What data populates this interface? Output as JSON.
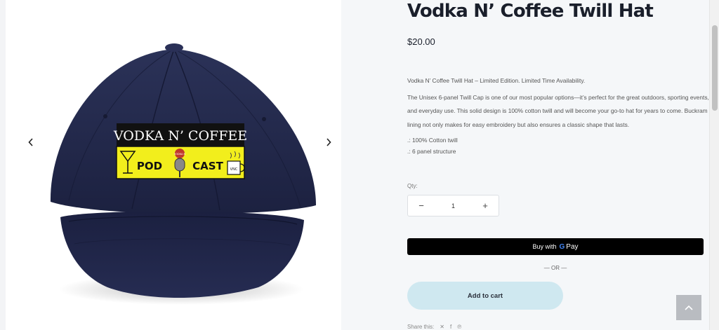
{
  "product": {
    "title": "Vodka N’ Coffee Twill Hat",
    "price": "$20.00",
    "description": {
      "intro": "Vodka N’ Coffee Twill Hat – Limited Edition.  Limited Time Availability.",
      "body": "The Unisex 6-panel Twill Cap is one of our most popular options—it’s perfect for the great outdoors, sporting events, and everyday use. This solid design is 100% cotton twill and will become your go-to hat for years to come. Buckram lining not only makes for easy embroidery but also ensures a classic shape that lasts.",
      "bullets": [
        ".: 100% Cotton twill",
        ".: 6 panel structure"
      ]
    }
  },
  "hat": {
    "patch_title": "VODKA N’ COFFEE",
    "patch_left": "POD",
    "patch_right": "CAST",
    "mug_text": "VNC",
    "mic_tag": "VODKA N",
    "colors": {
      "cap": "#23294a",
      "patch_bg": "#f2ee1c",
      "patch_header": "#111111"
    }
  },
  "quantity": {
    "label": "Qty:",
    "value": "1",
    "minus": "−",
    "plus": "+"
  },
  "buttons": {
    "gpay_prefix": "Buy with",
    "gpay_g": "G",
    "gpay_pay": "Pay",
    "or_divider": "— OR —",
    "add_to_cart": "Add to cart"
  },
  "share": {
    "label": "Share this:"
  },
  "gallery": {
    "prev_icon": "chevron-left-icon",
    "next_icon": "chevron-right-icon"
  },
  "colors": {
    "info_bg": "#f5f7f9",
    "cart_bg": "#cfe8f0",
    "gpay_bg": "#000000",
    "back_to_top_bg": "#b9bcc1"
  }
}
